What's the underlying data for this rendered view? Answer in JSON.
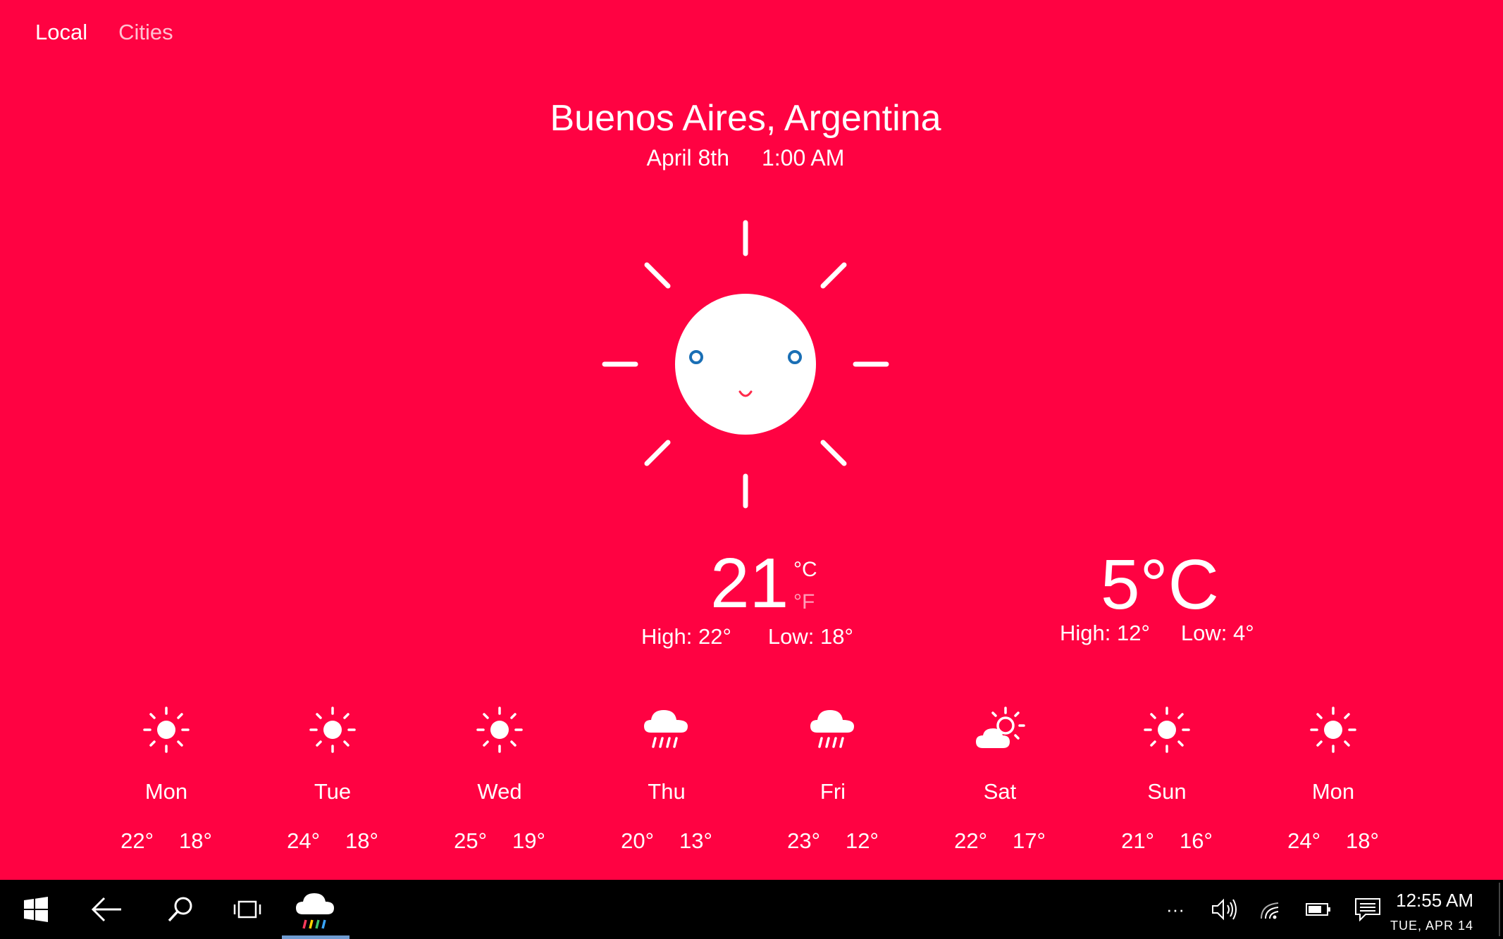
{
  "nav": {
    "tabs": [
      {
        "label": "Local",
        "active": true
      },
      {
        "label": "Cities",
        "active": false
      }
    ]
  },
  "location": {
    "city": "Buenos Aires, Argentina",
    "date": "April 8th",
    "time": "1:00 AM"
  },
  "current": {
    "condition_icon": "smiling-sun-icon",
    "temp": "21",
    "unit_c": "°C",
    "unit_f": "°F",
    "high": "High: 22°",
    "low": "Low: 18°"
  },
  "secondary": {
    "temp": "5°C",
    "high": "High: 12°",
    "low": "Low: 4°"
  },
  "forecast": [
    {
      "day": "Mon",
      "high": "22°",
      "low": "18°",
      "icon": "sun"
    },
    {
      "day": "Tue",
      "high": "24°",
      "low": "18°",
      "icon": "sun"
    },
    {
      "day": "Wed",
      "high": "25°",
      "low": "19°",
      "icon": "sun"
    },
    {
      "day": "Thu",
      "high": "20°",
      "low": "13°",
      "icon": "rain"
    },
    {
      "day": "Fri",
      "high": "23°",
      "low": "12°",
      "icon": "rain"
    },
    {
      "day": "Sat",
      "high": "22°",
      "low": "17°",
      "icon": "partly-cloudy"
    },
    {
      "day": "Sun",
      "high": "21°",
      "low": "16°",
      "icon": "sun"
    },
    {
      "day": "Mon",
      "high": "24°",
      "low": "18°",
      "icon": "sun"
    }
  ],
  "taskbar": {
    "overflow_label": "···",
    "clock_time": "12:55 AM",
    "clock_date": "TUE, APR 14"
  },
  "colors": {
    "background": "#ff0242",
    "eye": "#1a6fb5",
    "mouth": "#ff2a4a",
    "taskbar": "#000000"
  }
}
